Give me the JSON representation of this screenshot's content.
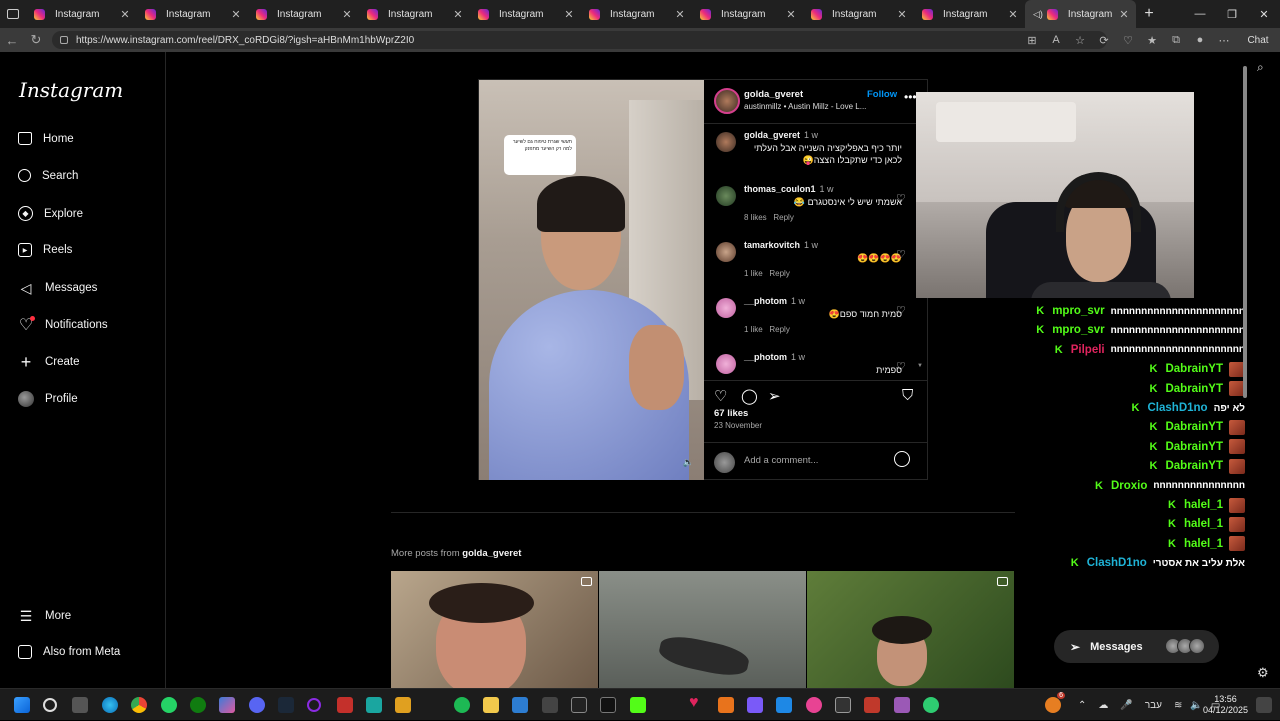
{
  "browser": {
    "tabs": [
      {
        "title": "Instagram",
        "active": false
      },
      {
        "title": "Instagram",
        "active": false
      },
      {
        "title": "Instagram",
        "active": false
      },
      {
        "title": "Instagram",
        "active": false
      },
      {
        "title": "Instagram",
        "active": false
      },
      {
        "title": "Instagram",
        "active": false
      },
      {
        "title": "Instagram",
        "active": false
      },
      {
        "title": "Instagram",
        "active": false
      },
      {
        "title": "Instagram",
        "active": false
      },
      {
        "title": "Instagram",
        "active": true
      }
    ],
    "url": "https://www.instagram.com/reel/DRX_coRDGi8/?igsh=aHBnMm1hbWprZ2I0",
    "chat_label": "Chat"
  },
  "sidebar": {
    "logo": "Instagram",
    "items": [
      {
        "label": "Home",
        "icon": "home-icon"
      },
      {
        "label": "Search",
        "icon": "search-icon"
      },
      {
        "label": "Explore",
        "icon": "compass-icon"
      },
      {
        "label": "Reels",
        "icon": "reels-icon"
      },
      {
        "label": "Messages",
        "icon": "messenger-icon"
      },
      {
        "label": "Notifications",
        "icon": "heart-icon"
      },
      {
        "label": "Create",
        "icon": "plus-icon"
      },
      {
        "label": "Profile",
        "icon": "avatar-icon"
      }
    ],
    "more": "More",
    "meta": "Also from Meta"
  },
  "post": {
    "username": "golda_gveret",
    "subtitle": "austinmillz • Austin Millz - Love L...",
    "follow": "Follow",
    "image_caption": "תעשי שגרת טיפוח גם לשיער למה רק השיער מתפנק",
    "comments": [
      {
        "user": "golda_gveret",
        "time": "1 w",
        "text": "יותר כיף באפליקציה השנייה אבל העלתי לכאן כדי שתקבלו הצצה😜",
        "likes": "",
        "reply": ""
      },
      {
        "user": "thomas_coulon1",
        "time": "1 w",
        "text": "אשמתי שיש לי אינסטגרם 😂",
        "likes": "8 likes",
        "reply": "Reply"
      },
      {
        "user": "tamarkovitch",
        "time": "1 w",
        "text": "😍😍😍😍",
        "likes": "1 like",
        "reply": "Reply"
      },
      {
        "user": "__photom",
        "time": "1 w",
        "text": "סמית חמוד ספם😍",
        "likes": "1 like",
        "reply": "Reply"
      },
      {
        "user": "__photom",
        "time": "1 w",
        "text": "ספמית",
        "likes": "",
        "reply": ""
      }
    ],
    "likes": "67 likes",
    "date": "23 November",
    "add_comment": "Add a comment..."
  },
  "more_posts": {
    "label_prefix": "More posts from",
    "username": "golda_gveret"
  },
  "stream_chat": [
    {
      "name": "mpro_svr",
      "color": "#53fc18",
      "msg": "nnnnnnnnnnnnnnnnnnnnnn",
      "emote": 0
    },
    {
      "name": "mpro_svr",
      "color": "#53fc18",
      "msg": "nnnnnnnnnnnnnnnnnnnnnn",
      "emote": 0
    },
    {
      "name": "Pilpeli",
      "color": "#e0245e",
      "msg": "nnnnnnnnnnnnnnnnnnnnnn",
      "emote": 0
    },
    {
      "name": "DabrainYT",
      "color": "#53fc18",
      "msg": "",
      "emote": 1
    },
    {
      "name": "DabrainYT",
      "color": "#53fc18",
      "msg": "",
      "emote": 1
    },
    {
      "name": "ClashD1no",
      "color": "#1fb3d6",
      "msg": "לא יפה",
      "emote": 0
    },
    {
      "name": "DabrainYT",
      "color": "#53fc18",
      "msg": "",
      "emote": 1
    },
    {
      "name": "DabrainYT",
      "color": "#53fc18",
      "msg": "",
      "emote": 1
    },
    {
      "name": "DabrainYT",
      "color": "#53fc18",
      "msg": "",
      "emote": 1
    },
    {
      "name": "Droxio",
      "color": "#53fc18",
      "msg": "nnnnnnnnnnnnnnn",
      "emote": 0
    },
    {
      "name": "halel_1",
      "color": "#53fc18",
      "msg": "",
      "emote": 1
    },
    {
      "name": "halel_1",
      "color": "#53fc18",
      "msg": "",
      "emote": 1
    },
    {
      "name": "halel_1",
      "color": "#53fc18",
      "msg": "",
      "emote": 1
    },
    {
      "name": "ClashD1no",
      "color": "#1fb3d6",
      "msg": "אלת עליב את אסטרי",
      "emote": 0
    }
  ],
  "messages_pill": "Messages",
  "taskbar": {
    "lang": "עבר",
    "time": "13:56",
    "date": "04/12/2025",
    "badge": "6"
  }
}
